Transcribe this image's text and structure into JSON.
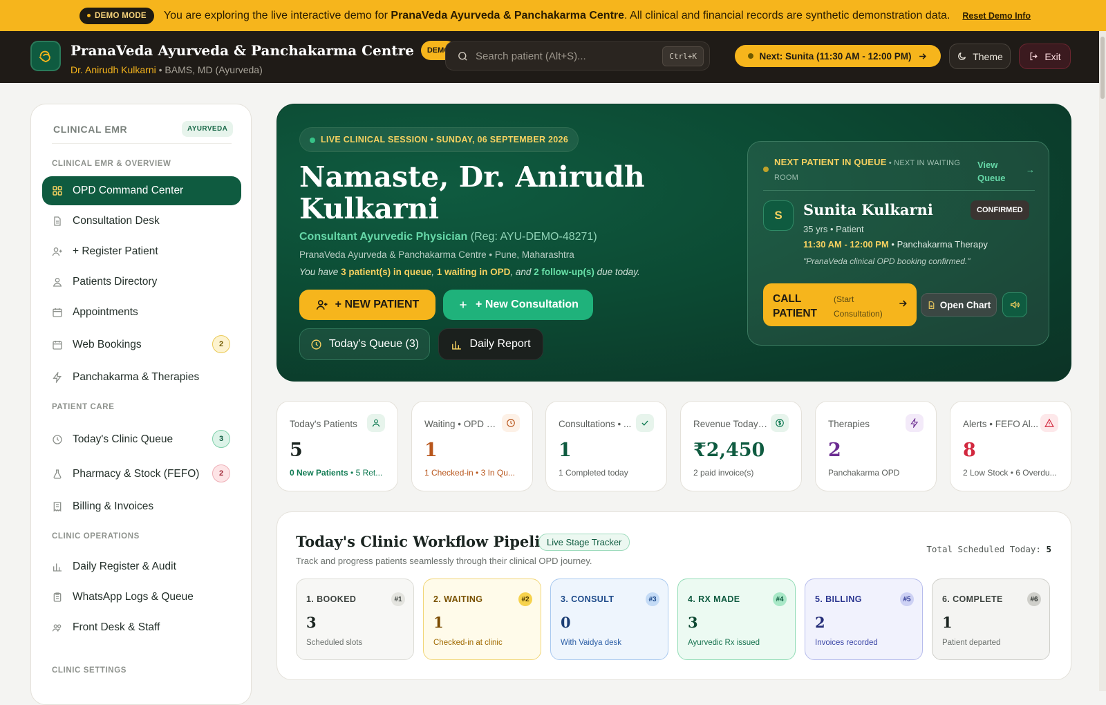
{
  "demo_banner": {
    "pill": "DEMO MODE",
    "text_before": "You are exploring the live interactive demo for ",
    "text_bold": "PranaVeda Ayurveda & Panchakarma Centre",
    "text_after": ". All clinical and financial records are synthetic demonstration data.",
    "reset": "Reset Demo Info"
  },
  "header": {
    "title": "PranaVeda Ayurveda & Panchakarma Centre",
    "badge": "DEMO",
    "doctor": "Dr. Anirudh Kulkarni",
    "qualification": " • BAMS, MD (Ayurveda)",
    "search_placeholder": "Search patient (Alt+S)...",
    "search_shortcut": "Ctrl+K",
    "next_label": "Next: Sunita (11:30 AM - 12:00 PM)",
    "theme": "Theme",
    "exit": "Exit"
  },
  "sidebar": {
    "header": "CLINICAL EMR",
    "tag": "AYURVEDA",
    "sections": {
      "overview": "CLINICAL EMR & OVERVIEW",
      "patient_care": "PATIENT CARE",
      "operations": "CLINIC OPERATIONS",
      "settings": "CLINIC SETTINGS"
    },
    "items": [
      {
        "label": "OPD Command Center"
      },
      {
        "label": "Consultation Desk"
      },
      {
        "label": "+ Register Patient"
      },
      {
        "label": "Patients Directory"
      },
      {
        "label": "Appointments"
      },
      {
        "label": "Web Bookings",
        "badge": "2"
      },
      {
        "label": "Panchakarma & Therapies"
      },
      {
        "label": "Today's Clinic Queue",
        "badge": "3"
      },
      {
        "label": "Pharmacy & Stock (FEFO)",
        "badge": "2"
      },
      {
        "label": "Billing & Invoices"
      },
      {
        "label": "Daily Register & Audit"
      },
      {
        "label": "WhatsApp Logs & Queue"
      },
      {
        "label": "Front Desk & Staff"
      }
    ]
  },
  "hero": {
    "session": "LIVE CLINICAL SESSION • SUNDAY, 06 SEPTEMBER 2026",
    "greeting": "Namaste, Dr. Anirudh Kulkarni",
    "role": "Consultant Ayurvedic Physician",
    "reg": " (Reg: AYU-DEMO-48271)",
    "address": "PranaVeda Ayurveda & Panchakarma Centre • Pune, Maharashtra",
    "note": {
      "p1": "You have ",
      "q": "3 patient(s) in queue",
      "p2": ", ",
      "w": "1 waiting in OPD",
      "p3": ", and ",
      "f": "2 follow-up(s)",
      "p4": " due today."
    },
    "btn_new_patient": "+ NEW PATIENT",
    "btn_new_consult": "+ New Consultation",
    "btn_queue": "Today's Queue (3)",
    "btn_report": "Daily Report"
  },
  "next_patient": {
    "heading": "NEXT PATIENT IN QUEUE",
    "sub": " • NEXT IN WAITING ROOM",
    "view": "View Queue",
    "initial": "S",
    "name": "Sunita Kulkarni",
    "status": "CONFIRMED",
    "age": "35 yrs • Patient",
    "time": "11:30 AM - 12:00 PM",
    "service": " •  Panchakarma Therapy",
    "quote": "\"PranaVeda clinical OPD booking confirmed.\"",
    "call": "CALL PATIENT",
    "call_sub": "(Start Consultation)",
    "open_chart": "Open Chart"
  },
  "stats": [
    {
      "label": "Today's Patients",
      "value": "5",
      "sub_strong": "0 New Patients",
      "sub": " • 5 Ret...",
      "color": "#1a2420",
      "sub_color": "#0f7a52"
    },
    {
      "label": "Waiting • OPD Q...",
      "value": "1",
      "sub_strong": "",
      "sub": "1 Checked-in • 3 In Qu...",
      "color": "#b8561c",
      "sub_color": "#b8561c"
    },
    {
      "label": "Consultations • ...",
      "value": "1",
      "sub_strong": "",
      "sub": "1 Completed today",
      "color": "#0f5b40",
      "sub_color": "#5d615e"
    },
    {
      "label": "Revenue Today •...",
      "value": "₹2,450",
      "sub_strong": "",
      "sub": "2 paid invoice(s)",
      "color": "#0f5b40",
      "sub_color": "#5d615e"
    },
    {
      "label": "Therapies",
      "value": "2",
      "sub_strong": "",
      "sub": "Panchakarma OPD",
      "color": "#6b2c91",
      "sub_color": "#5d615e"
    },
    {
      "label": "Alerts • FEFO Al...",
      "value": "8",
      "sub_strong": "",
      "sub": "2 Low Stock • 6 Overdu...",
      "color": "#d2283e",
      "sub_color": "#5d615e"
    }
  ],
  "workflow": {
    "title": "Today's Clinic Workflow Pipeline",
    "tag": "Live Stage Tracker",
    "total_label": "Total Scheduled Today: ",
    "total": "5",
    "desc": "Track and progress patients seamlessly through their clinical OPD journey.",
    "stages": [
      {
        "name": "1. BOOKED",
        "num": "#1",
        "value": "3",
        "desc": "Scheduled slots"
      },
      {
        "name": "2. WAITING",
        "num": "#2",
        "value": "1",
        "desc": "Checked-in at clinic"
      },
      {
        "name": "3. CONSULT",
        "num": "#3",
        "value": "0",
        "desc": "With Vaidya desk"
      },
      {
        "name": "4. RX MADE",
        "num": "#4",
        "value": "3",
        "desc": "Ayurvedic Rx issued"
      },
      {
        "name": "5. BILLING",
        "num": "#5",
        "value": "2",
        "desc": "Invoices recorded"
      },
      {
        "name": "6. COMPLETE",
        "num": "#6",
        "value": "1",
        "desc": "Patient departed"
      }
    ]
  },
  "colors": {
    "brand_green": "#0f5b40",
    "accent_yellow": "#f6b51c",
    "header_dark": "#1f1b17"
  }
}
